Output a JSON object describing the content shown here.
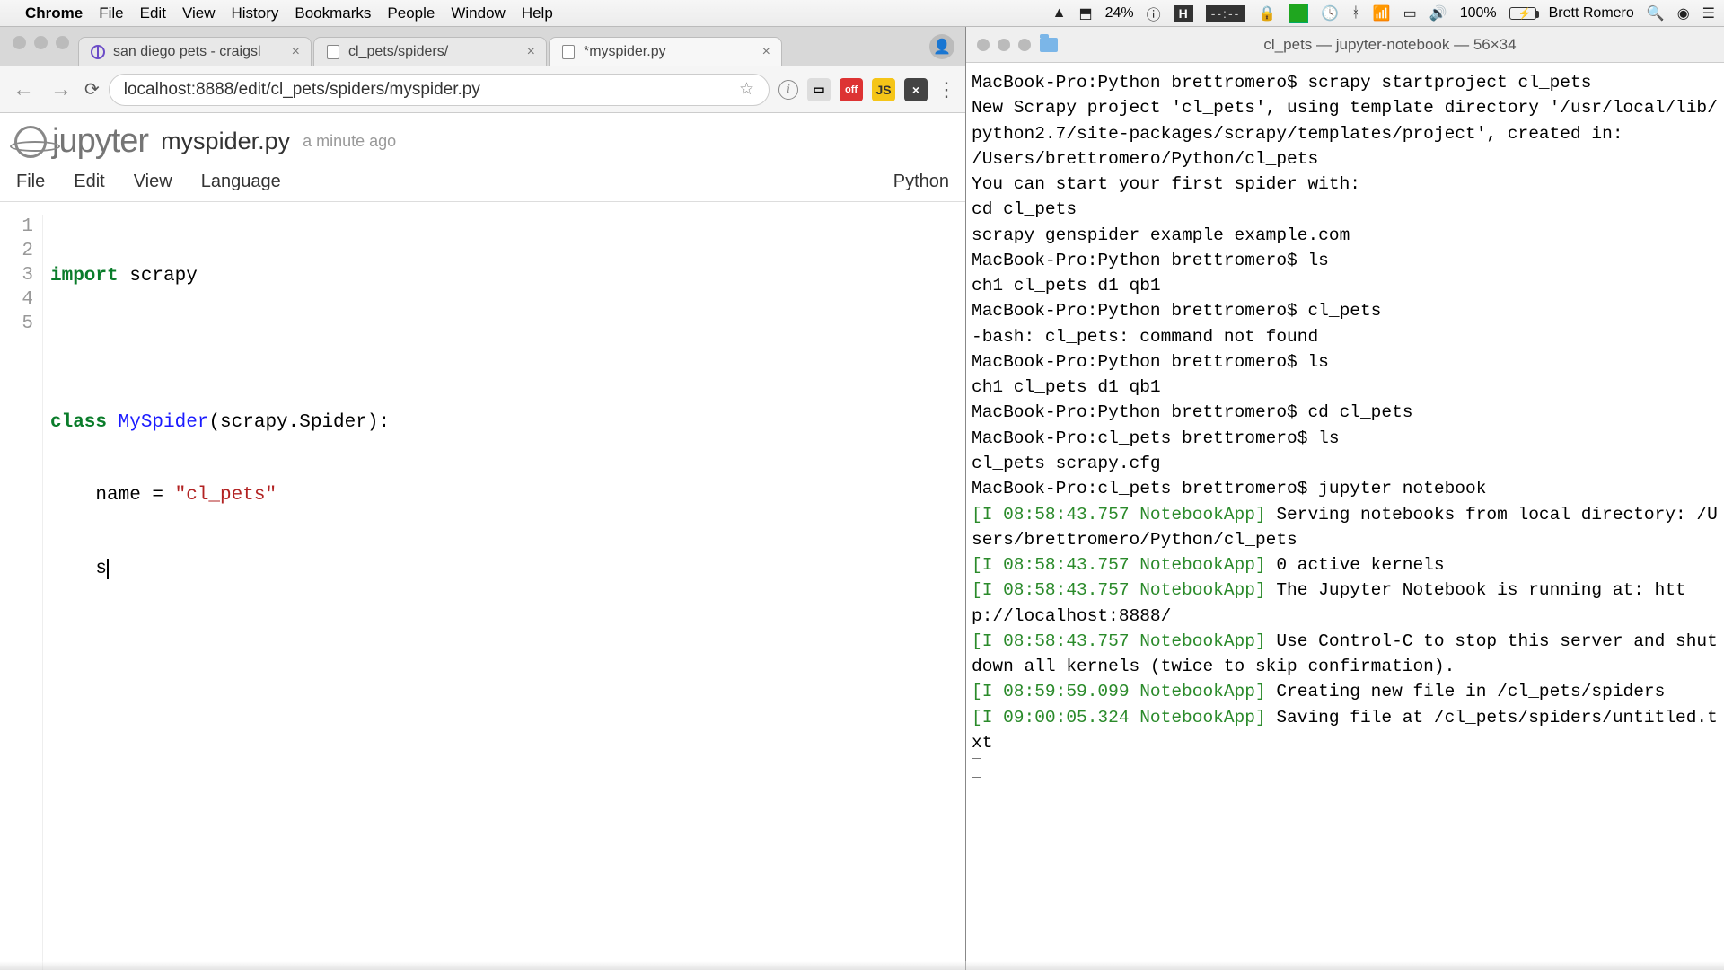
{
  "menubar": {
    "app": "Chrome",
    "items": [
      "File",
      "Edit",
      "View",
      "History",
      "Bookmarks",
      "People",
      "Window",
      "Help"
    ],
    "zoom": "24%",
    "battery": "100%",
    "user": "Brett Romero",
    "h_badge": "H",
    "dash": "--:--"
  },
  "chrome": {
    "tabs": [
      {
        "title": "san diego pets - craigsl",
        "active": false
      },
      {
        "title": "cl_pets/spiders/",
        "active": false
      },
      {
        "title": "*myspider.py",
        "active": true
      }
    ],
    "url": "localhost:8888/edit/cl_pets/spiders/myspider.py",
    "ext_off": "off",
    "ext_js": "JS"
  },
  "jupyter": {
    "logo": "jupyter",
    "filename": "myspider.py",
    "timestamp": "a minute ago",
    "menu": [
      "File",
      "Edit",
      "View",
      "Language"
    ],
    "language": "Python"
  },
  "code": {
    "lines": [
      "1",
      "2",
      "3",
      "4",
      "5"
    ],
    "l1_kw": "import",
    "l1_rest": " scrapy",
    "l3_kw": "class",
    "l3_cls": " MySpider",
    "l3_rest": "(scrapy.Spider):",
    "l4_pre": "    name = ",
    "l4_str": "\"cl_pets\"",
    "l5": "    s"
  },
  "terminal": {
    "title": "cl_pets — jupyter-notebook — 56×34",
    "lines": [
      {
        "t": "MacBook-Pro:Python brettromero$ scrapy startproject cl_pets"
      },
      {
        "t": "New Scrapy project 'cl_pets', using template directory '/usr/local/lib/python2.7/site-packages/scrapy/templates/project', created in:"
      },
      {
        "t": "    /Users/brettromero/Python/cl_pets"
      },
      {
        "t": ""
      },
      {
        "t": "You can start your first spider with:"
      },
      {
        "t": "    cd cl_pets"
      },
      {
        "t": "    scrapy genspider example example.com"
      },
      {
        "t": "MacBook-Pro:Python brettromero$ ls"
      },
      {
        "t": "ch1     cl_pets d1      qb1"
      },
      {
        "t": "MacBook-Pro:Python brettromero$ cl_pets"
      },
      {
        "t": "-bash: cl_pets: command not found"
      },
      {
        "t": "MacBook-Pro:Python brettromero$ ls"
      },
      {
        "t": "ch1     cl_pets d1      qb1"
      },
      {
        "t": "MacBook-Pro:Python brettromero$ cd cl_pets"
      },
      {
        "t": "MacBook-Pro:cl_pets brettromero$ ls"
      },
      {
        "t": "cl_pets        scrapy.cfg"
      },
      {
        "t": "MacBook-Pro:cl_pets brettromero$ jupyter notebook"
      },
      {
        "log": "[I 08:58:43.757 NotebookApp]",
        "t": " Serving notebooks from local directory: /Users/brettromero/Python/cl_pets"
      },
      {
        "log": "[I 08:58:43.757 NotebookApp]",
        "t": " 0 active kernels"
      },
      {
        "log": "[I 08:58:43.757 NotebookApp]",
        "t": " The Jupyter Notebook is running at: http://localhost:8888/"
      },
      {
        "log": "[I 08:58:43.757 NotebookApp]",
        "t": " Use Control-C to stop this server and shut down all kernels (twice to skip confirmation)."
      },
      {
        "log": "[I 08:59:59.099 NotebookApp]",
        "t": " Creating new file in /cl_pets/spiders"
      },
      {
        "log": "[I 09:00:05.324 NotebookApp]",
        "t": " Saving file at /cl_pets/spiders/untitled.txt"
      }
    ]
  }
}
